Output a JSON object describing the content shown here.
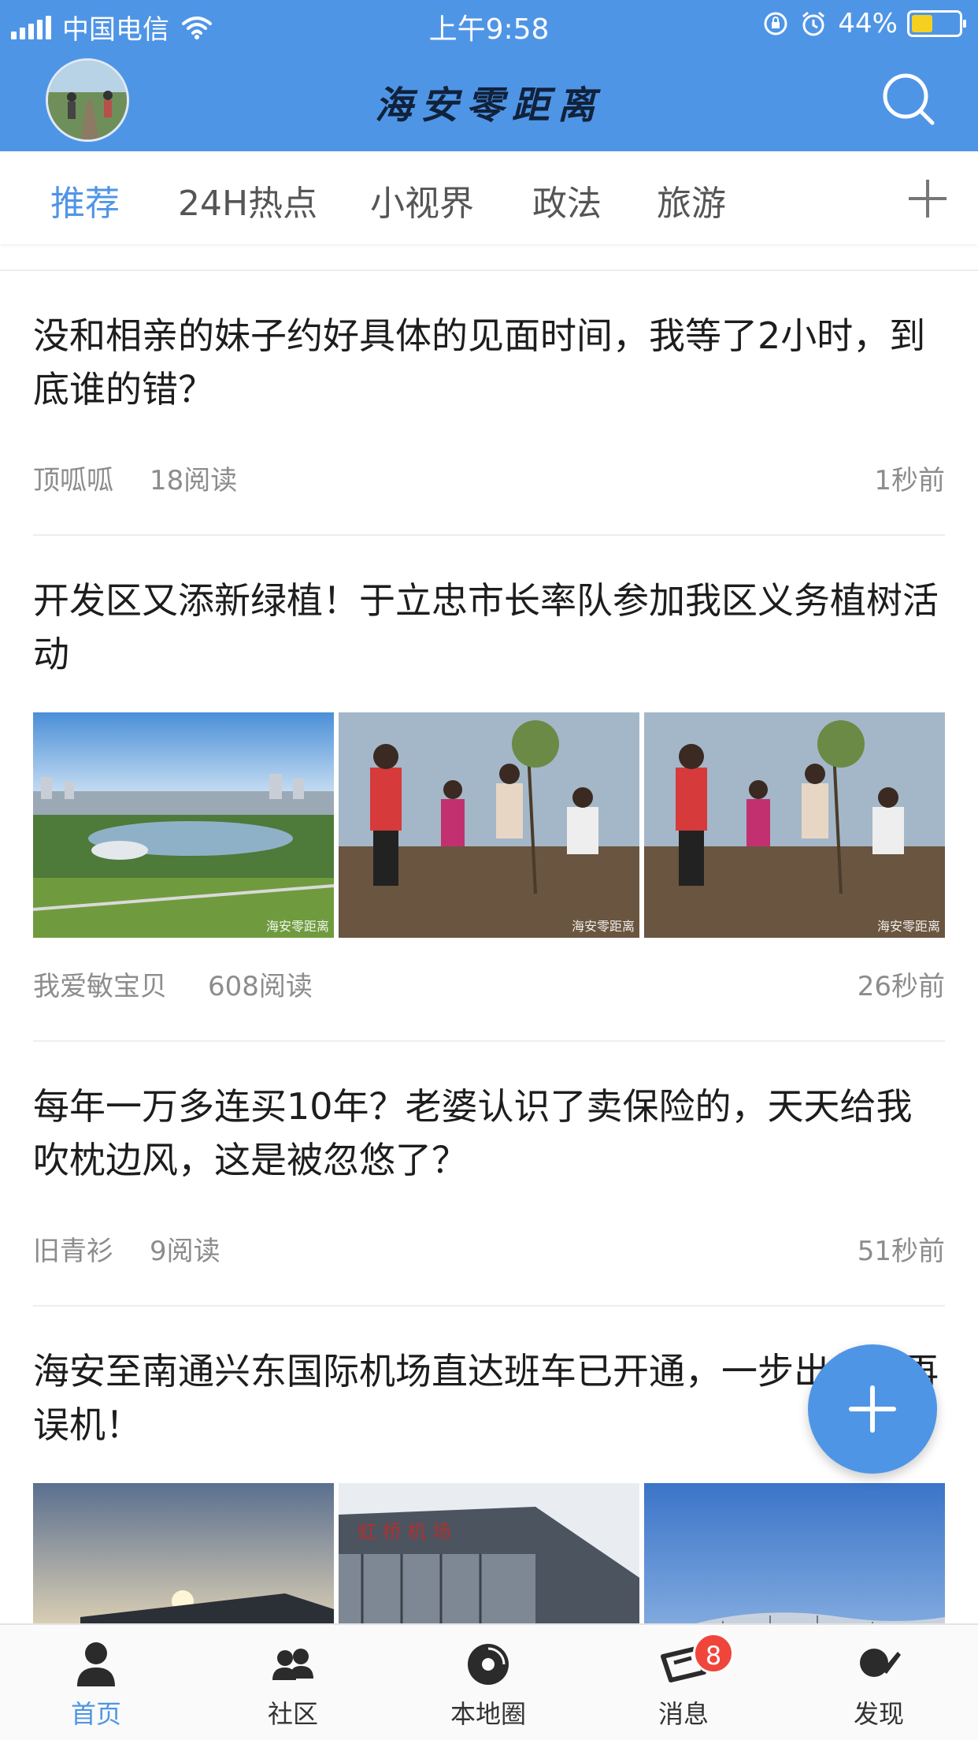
{
  "status_bar": {
    "carrier": "中国电信",
    "time": "上午9:58",
    "battery": "44%",
    "battery_level": 0.44
  },
  "header": {
    "title": "海安零距离",
    "avatar_icon": "user-avatar",
    "search_icon": "search-icon"
  },
  "tabs": [
    {
      "label": "推荐",
      "active": true
    },
    {
      "label": "24H热点",
      "active": false
    },
    {
      "label": "小视界",
      "active": false
    },
    {
      "label": "政法",
      "active": false
    },
    {
      "label": "旅游",
      "active": false
    }
  ],
  "feed": [
    {
      "headline": "没和相亲的妹子约好具体的见面时间，我等了2小时，到底谁的错？",
      "author": "顶呱呱",
      "reads": "18阅读",
      "time": "1秒前"
    },
    {
      "headline": "开发区又添新绿植！于立忠市长率队参加我区义务植树活动",
      "author": "我爱敏宝贝",
      "reads": "608阅读",
      "time": "26秒前",
      "images": [
        "city-lake-aerial",
        "tree-planting",
        "tree-planting"
      ]
    },
    {
      "headline": "每年一万多连买10年？老婆认识了卖保险的，天天给我吹枕边风，这是被忽悠了？",
      "author": "旧青衫",
      "reads": "9阅读",
      "time": "51秒前"
    },
    {
      "headline": "海安至南通兴东国际机场直达班车已开通，一步出行不再误机！",
      "images": [
        "airport-sunset",
        "airport-terminal",
        "airport-roof"
      ]
    }
  ],
  "bottom_nav": [
    {
      "label": "首页",
      "icon": "home-person-icon",
      "active": true
    },
    {
      "label": "社区",
      "icon": "community-icon",
      "active": false
    },
    {
      "label": "本地圈",
      "icon": "local-circle-icon",
      "active": false
    },
    {
      "label": "消息",
      "icon": "message-icon",
      "active": false,
      "badge": "8"
    },
    {
      "label": "发现",
      "icon": "discover-icon",
      "active": false
    }
  ],
  "colors": {
    "brand_blue": "#4f95e6",
    "badge_red": "#f0453b"
  }
}
